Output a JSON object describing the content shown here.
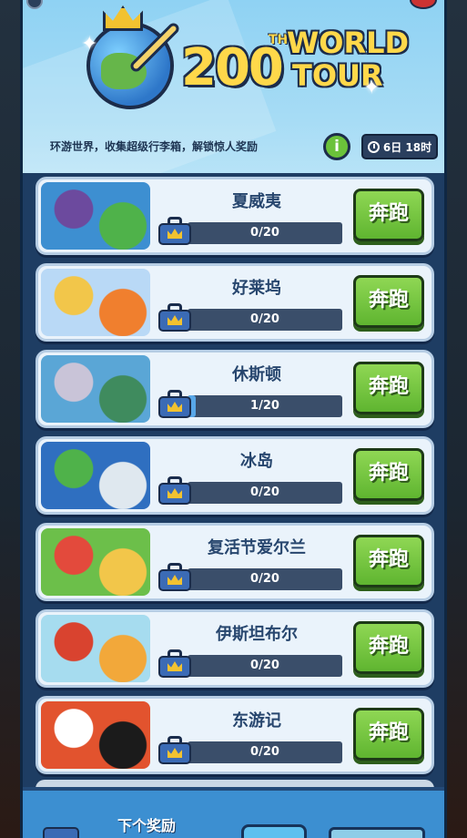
{
  "header": {
    "logo_number": "200",
    "logo_suffix": "TH",
    "logo_line1": "WORLD",
    "logo_line2": "TOUR",
    "tagline": "环游世界，收集超级行李箱，解锁惊人奖励",
    "info_label": "i",
    "timer": "6日 18时"
  },
  "destinations": [
    {
      "name": "夏威夷",
      "progress_text": "0/20",
      "progress": 0.0,
      "button": "奔跑",
      "colors": [
        "#3d8fd1",
        "#6c4a9e",
        "#4fb24a"
      ]
    },
    {
      "name": "好莱坞",
      "progress_text": "0/20",
      "progress": 0.0,
      "button": "奔跑",
      "colors": [
        "#b9d9f6",
        "#f2c64a",
        "#f07f2e"
      ]
    },
    {
      "name": "休斯顿",
      "progress_text": "1/20",
      "progress": 0.05,
      "button": "奔跑",
      "colors": [
        "#5aa6d6",
        "#c9c4d8",
        "#3f8b5e"
      ]
    },
    {
      "name": "冰岛",
      "progress_text": "0/20",
      "progress": 0.0,
      "button": "奔跑",
      "colors": [
        "#2f6fc0",
        "#4fb24a",
        "#dfe8ef"
      ]
    },
    {
      "name": "复活节爱尔兰",
      "progress_text": "0/20",
      "progress": 0.0,
      "button": "奔跑",
      "colors": [
        "#6cbf4a",
        "#e34a3c",
        "#f2c64a"
      ]
    },
    {
      "name": "伊斯坦布尔",
      "progress_text": "0/20",
      "progress": 0.0,
      "button": "奔跑",
      "colors": [
        "#a6dcef",
        "#d9432f",
        "#f2a83a"
      ]
    },
    {
      "name": "东游记",
      "progress_text": "0/20",
      "progress": 0.0,
      "button": "奔跑",
      "colors": [
        "#e2532e",
        "#ffffff",
        "#1b1b1b"
      ]
    }
  ],
  "footer": {
    "next_reward_label": "下个奖励"
  },
  "icons": {
    "suitcase": "crown-suitcase-icon",
    "timer": "stopwatch-icon",
    "info": "info-icon"
  }
}
